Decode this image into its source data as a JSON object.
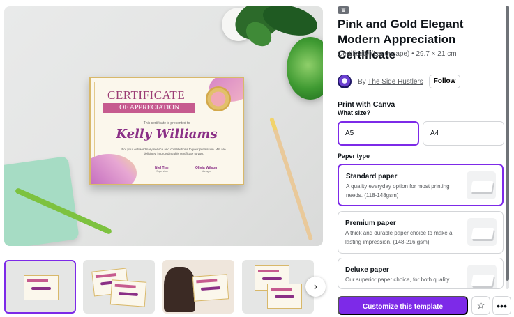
{
  "template": {
    "title": "Pink and Gold Elegant Modern Appreciation Certificate",
    "meta": "Certificate (Landscape) • 29.7 × 21 cm",
    "badge_icon": "crown-icon"
  },
  "author": {
    "by_label": "By",
    "name": "The Side Hustlers",
    "follow_label": "Follow"
  },
  "print": {
    "heading": "Print with Canva",
    "size_heading": "What size?",
    "sizes": [
      "A5",
      "A4"
    ],
    "selected_size": "A5",
    "paper_heading": "Paper type",
    "papers": [
      {
        "name": "Standard paper",
        "desc": "A quality everyday option for most printing needs. (118-148gsm)"
      },
      {
        "name": "Premium paper",
        "desc": "A thick and durable paper choice to make a lasting impression. (148-216 gsm)"
      },
      {
        "name": "Deluxe paper",
        "desc": "Our superior paper choice, for both quality"
      }
    ]
  },
  "certificate_preview": {
    "title": "CERTIFICATE",
    "subtitle": "OF APPRECIATION",
    "presented": "This certificate is presented to",
    "name": "Kelly Williams",
    "body": "For your extraordinary service and contributions to your profession. We are delighted in providing this certificate to you.",
    "signer1": "Niel Tran",
    "signer1_role": "Supervisor",
    "signer2": "Olivia Wilson",
    "signer2_role": "Manager"
  },
  "actions": {
    "customize_label": "Customize this template",
    "favorite_icon": "star-icon",
    "more_icon": "more-icon",
    "next_icon": "chevron-right-icon"
  },
  "colors": {
    "accent": "#7d2ae8",
    "text": "#0e1318",
    "muted": "#575a5e"
  }
}
